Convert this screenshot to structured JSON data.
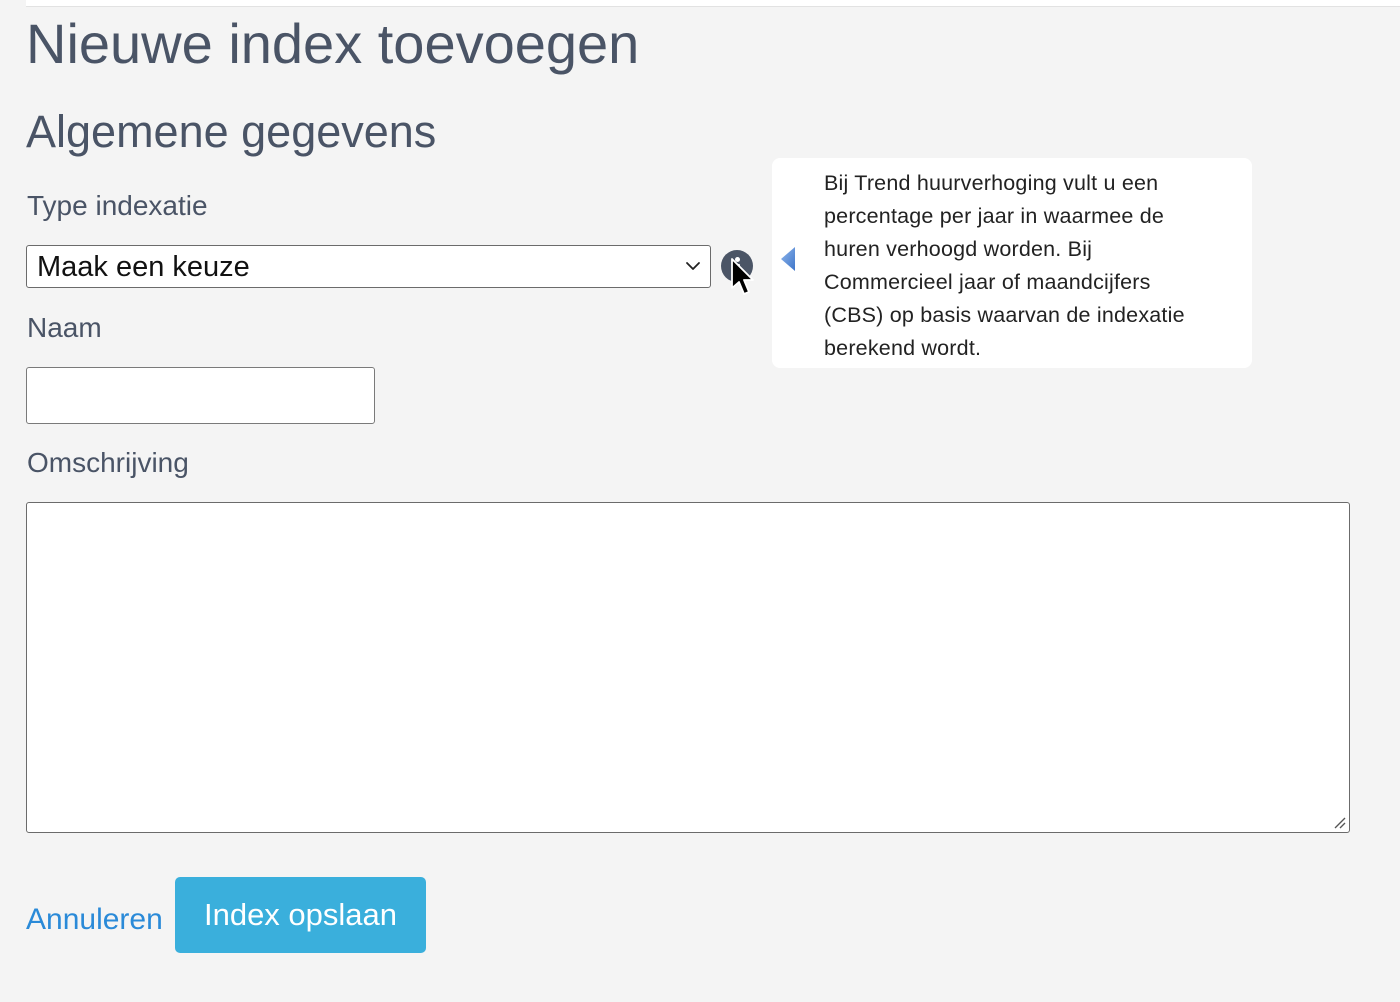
{
  "page": {
    "title": "Nieuwe index toevoegen",
    "section_title": "Algemene gegevens"
  },
  "form": {
    "type": {
      "label": "Type indexatie",
      "selected": "Maak een keuze"
    },
    "name": {
      "label": "Naam",
      "value": ""
    },
    "description": {
      "label": "Omschrijving",
      "value": ""
    }
  },
  "tooltip": {
    "lines": [
      "Bij Trend huurverhoging vult u een",
      "percentage per jaar in waarmee de",
      "huren verhoogd worden. Bij",
      "Commercieel jaar of maandcijfers",
      "(CBS) op basis waarvan de indexatie",
      "berekend wordt."
    ]
  },
  "actions": {
    "cancel_label": "Annuleren",
    "save_label": "Index opslaan"
  },
  "icons": {
    "info": "info-icon",
    "chevron": "chevron-down-icon",
    "tooltip_arrow": "arrow-left-icon",
    "cursor": "mouse-pointer-icon",
    "resize": "resize-grip-icon"
  },
  "colors": {
    "background": "#f4f4f4",
    "heading": "#4a5466",
    "link": "#2a8ad8",
    "primary_button": "#3aafdc",
    "info_icon": "#4b5566",
    "tooltip_arrow": "#5b8fd6"
  }
}
